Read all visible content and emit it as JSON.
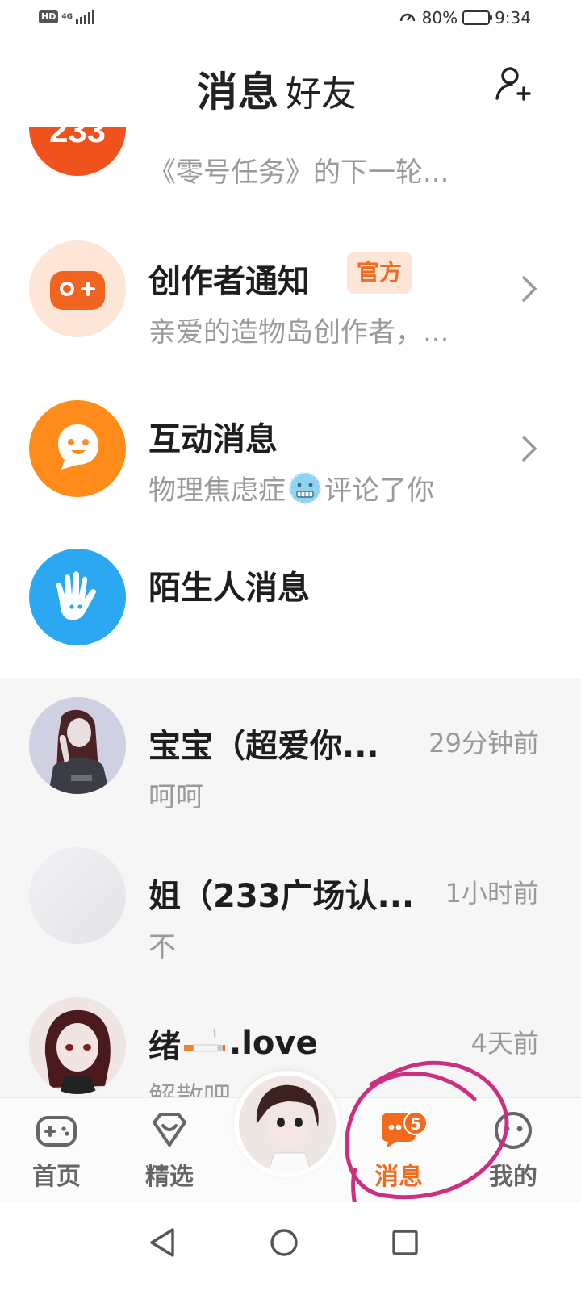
{
  "status_bar": {
    "hd": "HD",
    "network": "4G",
    "battery_text": "80%",
    "battery_level": 0.8,
    "time": "9:34"
  },
  "header": {
    "tab_messages": "消息",
    "tab_friends": "好友",
    "add_friend_icon": "add-user-icon"
  },
  "messages": [
    {
      "icon": "233-logo",
      "subtitle": "《零号任务》的下一轮..."
    },
    {
      "icon": "gamepad-icon",
      "title": "创作者通知",
      "badge": "官方",
      "subtitle": "亲爱的造物岛创作者，..."
    },
    {
      "icon": "smiley-bubble-icon",
      "title": "互动消息",
      "subtitle_before": "物理焦虑症",
      "subtitle_after": "评论了你"
    },
    {
      "icon": "hand-icon",
      "title": "陌生人消息"
    }
  ],
  "chats": [
    {
      "name": "宝宝（超爱你...",
      "time": "29分钟前",
      "last": "呵呵"
    },
    {
      "name": "姐（233广场认...",
      "time": "1小时前",
      "last": "不"
    },
    {
      "name_before": "绪",
      "name_after": ".love",
      "time": "4天前",
      "last": "解散吧"
    }
  ],
  "bottom_nav": {
    "home": "首页",
    "featured": "精选",
    "messages": "消息",
    "messages_count": "5",
    "mine": "我的"
  },
  "colors": {
    "accent": "#f26a1b",
    "annotation": "#cc2f7f"
  }
}
